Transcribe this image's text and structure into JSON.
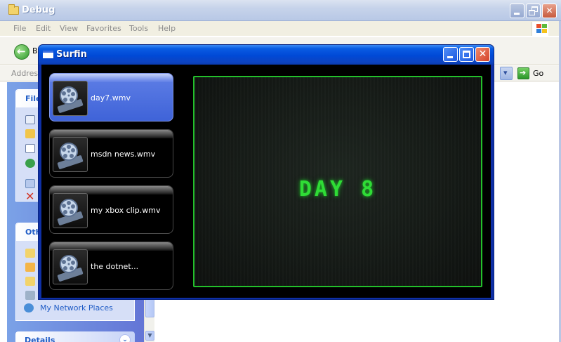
{
  "explorer": {
    "title": "Debug",
    "menu": [
      "File",
      "Edit",
      "View",
      "Favorites",
      "Tools",
      "Help"
    ],
    "back_label": "Ba",
    "address_label": "Address",
    "go_label": "Go",
    "taskpane": {
      "file_tasks_heading": "File",
      "other_places_heading": "Oth",
      "my_network_places": "My Network Places",
      "details_heading": "Details"
    }
  },
  "surfin": {
    "title": "Surfin",
    "playlist": [
      {
        "label": "day7.wmv",
        "selected": true
      },
      {
        "label": "msdn news.wmv",
        "selected": false
      },
      {
        "label": "my xbox clip.wmv",
        "selected": false
      },
      {
        "label": "the dotnet...",
        "selected": false
      }
    ],
    "video_text": "DAY 8"
  },
  "colors": {
    "accent_blue": "#0049d6",
    "selected_card": "#4f70e0",
    "video_border": "#23c02b",
    "video_text": "#2fdc36"
  }
}
